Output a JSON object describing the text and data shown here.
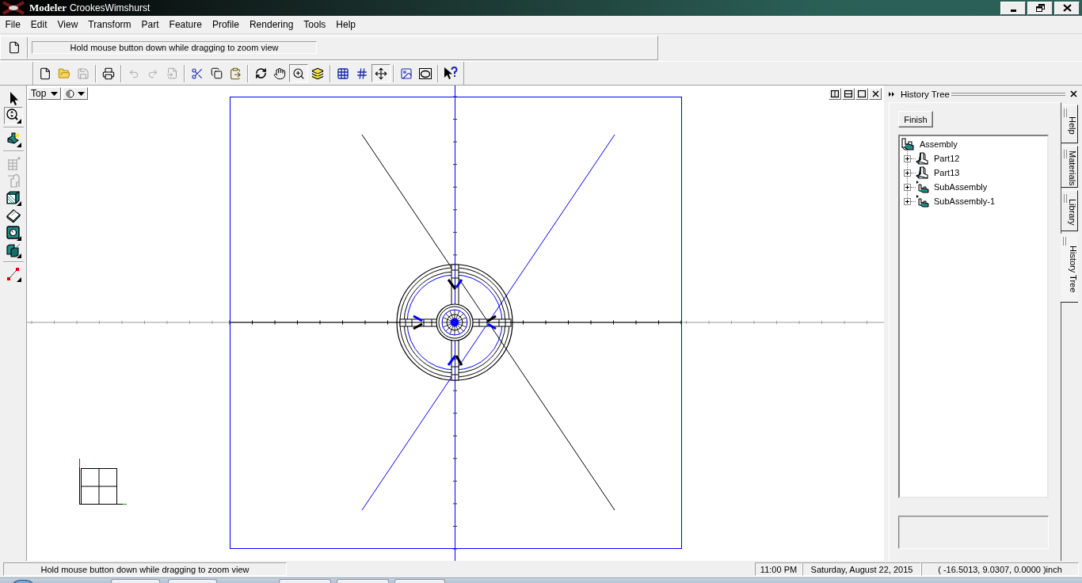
{
  "window": {
    "app_name": "Modeler",
    "title": "CrookesWimshurst"
  },
  "menu": [
    "File",
    "Edit",
    "View",
    "Transform",
    "Part",
    "Feature",
    "Profile",
    "Rendering",
    "Tools",
    "Help"
  ],
  "prompt": {
    "message": "Hold mouse button down while dragging to zoom view"
  },
  "toolbar": [
    [
      {
        "disabled": false,
        "pressed": false
      },
      {
        "disabled": false,
        "pressed": false
      },
      {
        "disabled": true,
        "pressed": false
      }
    ],
    [
      {
        "disabled": false,
        "pressed": false
      }
    ],
    [
      {
        "disabled": true,
        "pressed": false
      },
      {
        "disabled": true,
        "pressed": false
      },
      {
        "disabled": true,
        "pressed": false
      }
    ],
    [
      {
        "disabled": false,
        "pressed": false
      },
      {
        "disabled": false,
        "pressed": false
      },
      {
        "disabled": false,
        "pressed": false
      }
    ],
    [
      {
        "disabled": false,
        "pressed": false
      },
      {
        "disabled": false,
        "pressed": false
      },
      {
        "disabled": false,
        "pressed": true
      },
      {
        "disabled": false,
        "pressed": false
      }
    ],
    [
      {
        "disabled": false,
        "pressed": false
      },
      {
        "disabled": false,
        "pressed": false
      },
      {
        "disabled": false,
        "pressed": true
      }
    ],
    [
      {
        "disabled": false,
        "pressed": false
      },
      {
        "disabled": false,
        "pressed": false
      }
    ],
    [
      {
        "disabled": false,
        "pressed": false
      }
    ]
  ],
  "tool_palette": [
    [
      {
        "disabled": false,
        "pressed": false
      },
      {
        "disabled": false,
        "pressed": true
      }
    ],
    [
      {
        "disabled": false,
        "pressed": false
      }
    ],
    [
      {
        "disabled": true,
        "pressed": false
      },
      {
        "disabled": true,
        "pressed": false
      },
      {
        "disabled": false,
        "pressed": false
      },
      {
        "disabled": false,
        "pressed": false
      },
      {
        "disabled": false,
        "pressed": false
      },
      {
        "disabled": false,
        "pressed": false
      }
    ],
    [
      {
        "disabled": false,
        "pressed": false
      }
    ]
  ],
  "viewport": {
    "view": "Top"
  },
  "history_panel": {
    "title": "History Tree",
    "finish_button": "Finish",
    "tree": {
      "label": "Assembly",
      "children": [
        {
          "label": "Part12",
          "kind": "part",
          "expanded": false
        },
        {
          "label": "Part13",
          "kind": "part",
          "expanded": false
        },
        {
          "label": "SubAssembly",
          "kind": "subassembly",
          "expanded": false
        },
        {
          "label": "SubAssembly-1",
          "kind": "subassembly",
          "expanded": false
        }
      ]
    }
  },
  "side_tabs": [
    {
      "label": "Help",
      "selected": false
    },
    {
      "label": "Materials",
      "selected": false
    },
    {
      "label": "Library",
      "selected": false
    },
    {
      "label": "History Tree",
      "selected": true
    }
  ],
  "status_bar": {
    "message": "Hold mouse button down while dragging to zoom view",
    "time": "11:00 PM",
    "date": "Saturday, August 22, 2015",
    "coordinates": "( -16.5013, 9.0307, 0.0000 )inch"
  }
}
